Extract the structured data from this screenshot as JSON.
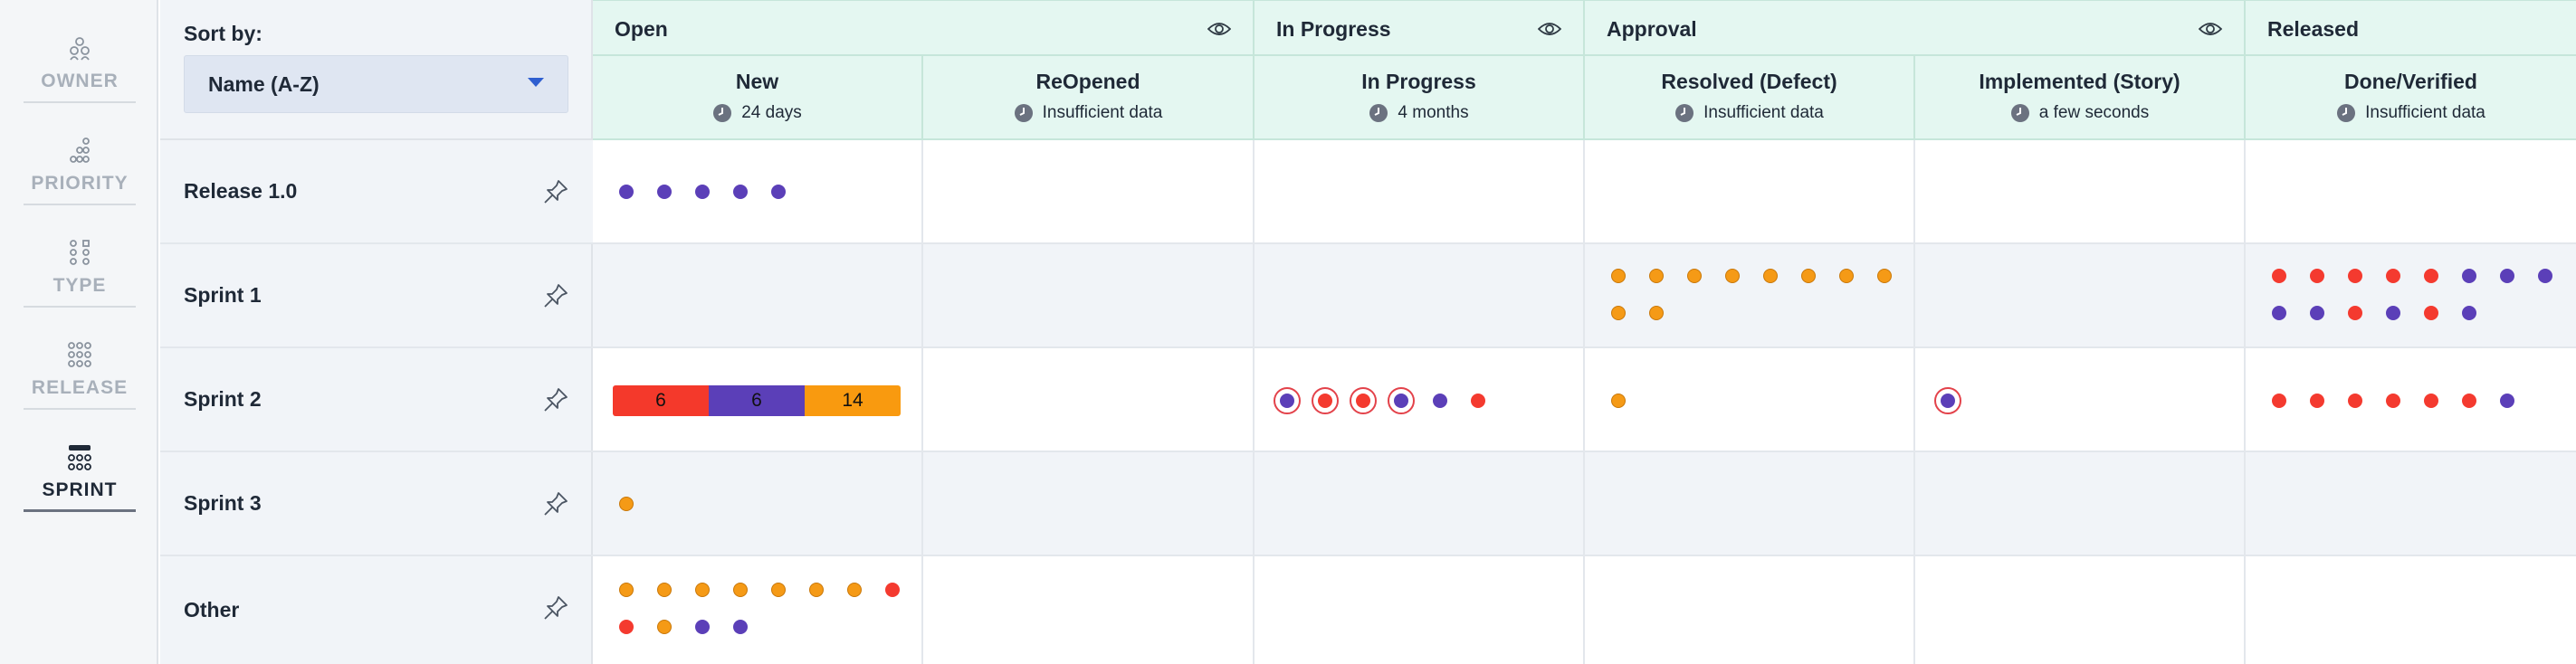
{
  "sidebar": {
    "groups": [
      {
        "label": "OWNER",
        "icon": "owner-icon",
        "active": false
      },
      {
        "label": "PRIORITY",
        "icon": "priority-icon",
        "active": false
      },
      {
        "label": "TYPE",
        "icon": "type-icon",
        "active": false
      },
      {
        "label": "RELEASE",
        "icon": "release-icon",
        "active": false
      },
      {
        "label": "SPRINT",
        "icon": "sprint-icon",
        "active": true
      }
    ]
  },
  "sort": {
    "label": "Sort by:",
    "value": "Name (A-Z)"
  },
  "rows": [
    {
      "name": "Release 1.0"
    },
    {
      "name": "Sprint 1"
    },
    {
      "name": "Sprint 2"
    },
    {
      "name": "Sprint 3"
    },
    {
      "name": "Other"
    }
  ],
  "groups": [
    {
      "name": "Open"
    },
    {
      "name": "In Progress"
    },
    {
      "name": "Approval"
    },
    {
      "name": "Released"
    }
  ],
  "columns": [
    {
      "name": "New",
      "duration": "24 days"
    },
    {
      "name": "ReOpened",
      "duration": "Insufficient data"
    },
    {
      "name": "In Progress",
      "duration": "4 months"
    },
    {
      "name": "Resolved (Defect)",
      "duration": "Insufficient data"
    },
    {
      "name": "Implemented (Story)",
      "duration": "a few seconds"
    },
    {
      "name": "Done/Verified",
      "duration": "Insufficient data"
    }
  ],
  "aggregate": {
    "red": "6",
    "purple": "6",
    "orange": "14"
  },
  "colors": {
    "purple": "#5b3fb8",
    "orange": "#f59a16",
    "red": "#f43a2f",
    "header_bg": "#e4f7f1"
  }
}
